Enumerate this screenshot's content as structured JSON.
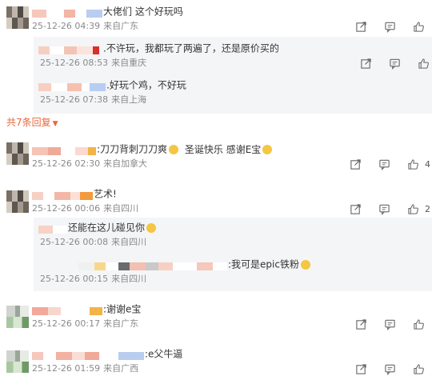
{
  "comments": [
    {
      "text": "大佬们 这个好玩吗",
      "meta": "25-12-26 04:39",
      "location": "来自广东",
      "likes": "",
      "replies": [
        {
          "text": ".不许玩，我都玩了两遍了，还是原价买的",
          "meta": "25-12-26 08:53",
          "location": "来自重庆"
        },
        {
          "text": ".好玩个鸡，不好玩",
          "meta": "25-12-26 07:38",
          "location": "来自上海"
        }
      ],
      "more_replies": "共7条回复"
    },
    {
      "text": ":刀刀背刺刀刀爽",
      "text_after": "圣诞快乐 感谢E宝",
      "meta": "25-12-26 02:30",
      "location": "来自加拿大",
      "likes": "4",
      "replies": []
    },
    {
      "text": "艺术!",
      "meta": "25-12-26 00:06",
      "location": "来自四川",
      "likes": "2",
      "replies": [
        {
          "text": "还能在这儿碰见你",
          "meta": "25-12-26 00:08",
          "location": "来自四川"
        },
        {
          "text": ":我可是epic铁粉",
          "meta": "25-12-26 00:15",
          "location": "来自四川"
        }
      ]
    },
    {
      "text": ":谢谢e宝",
      "meta": "25-12-26 00:17",
      "location": "来自广东",
      "likes": "",
      "replies": []
    },
    {
      "text": ":e父牛逼",
      "meta": "25-12-26 01:59",
      "location": "来自广西",
      "likes": "",
      "replies": []
    }
  ],
  "icons": [
    "share-icon",
    "comment-icon",
    "like-icon",
    "laugh-emoji-icon",
    "smile-emoji-icon",
    "chevron-down-icon"
  ],
  "colors": {
    "accent": "#e8673c",
    "meta_text": "#8a8a8a",
    "reply_bg": "#f4f5f7"
  }
}
